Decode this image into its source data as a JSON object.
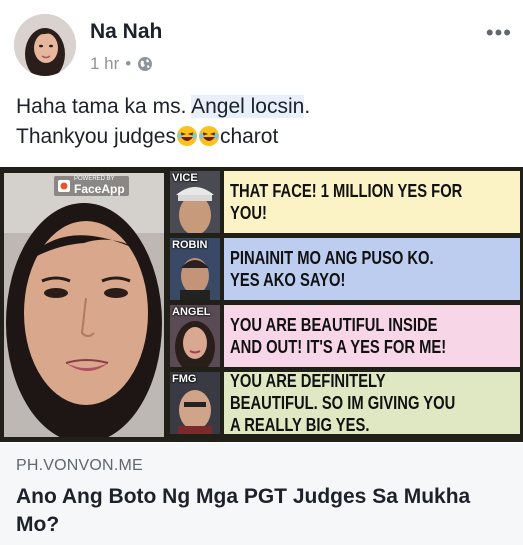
{
  "post": {
    "author": "Na Nah",
    "time": "1 hr",
    "separator": "•",
    "more": "•••",
    "text_line1_before": "Haha tama ka ms. ",
    "text_line1_highlight": "Angel locsin",
    "text_line1_after": ".",
    "text_line2_before": "Thankyou judges",
    "text_line2_after": "charot"
  },
  "share": {
    "badge_small": "POWERED BY",
    "badge_name": "FaceApp",
    "judges": [
      {
        "tag": "VICE",
        "quote": "THAT FACE! 1 MILLION YES FOR YOU!",
        "color": "#fbf2c6"
      },
      {
        "tag": "ROBIN",
        "quote": "PINAINIT MO ANG PUSO KO. YES AKO SAYO!",
        "color": "#bccdf0"
      },
      {
        "tag": "ANGEL",
        "quote": "YOU ARE BEAUTIFUL INSIDE AND OUT! IT'S A YES FOR ME!",
        "color": "#f7d6e8"
      },
      {
        "tag": "FMG",
        "quote": "YOU ARE DEFINITELY BEAUTIFUL. SO IM GIVING YOU A REALLY BIG YES.",
        "color": "#dfe8c2"
      }
    ],
    "domain": "PH.VONVON.ME",
    "title": "Ano Ang Boto Ng Mga PGT Judges Sa Mukha Mo?"
  }
}
